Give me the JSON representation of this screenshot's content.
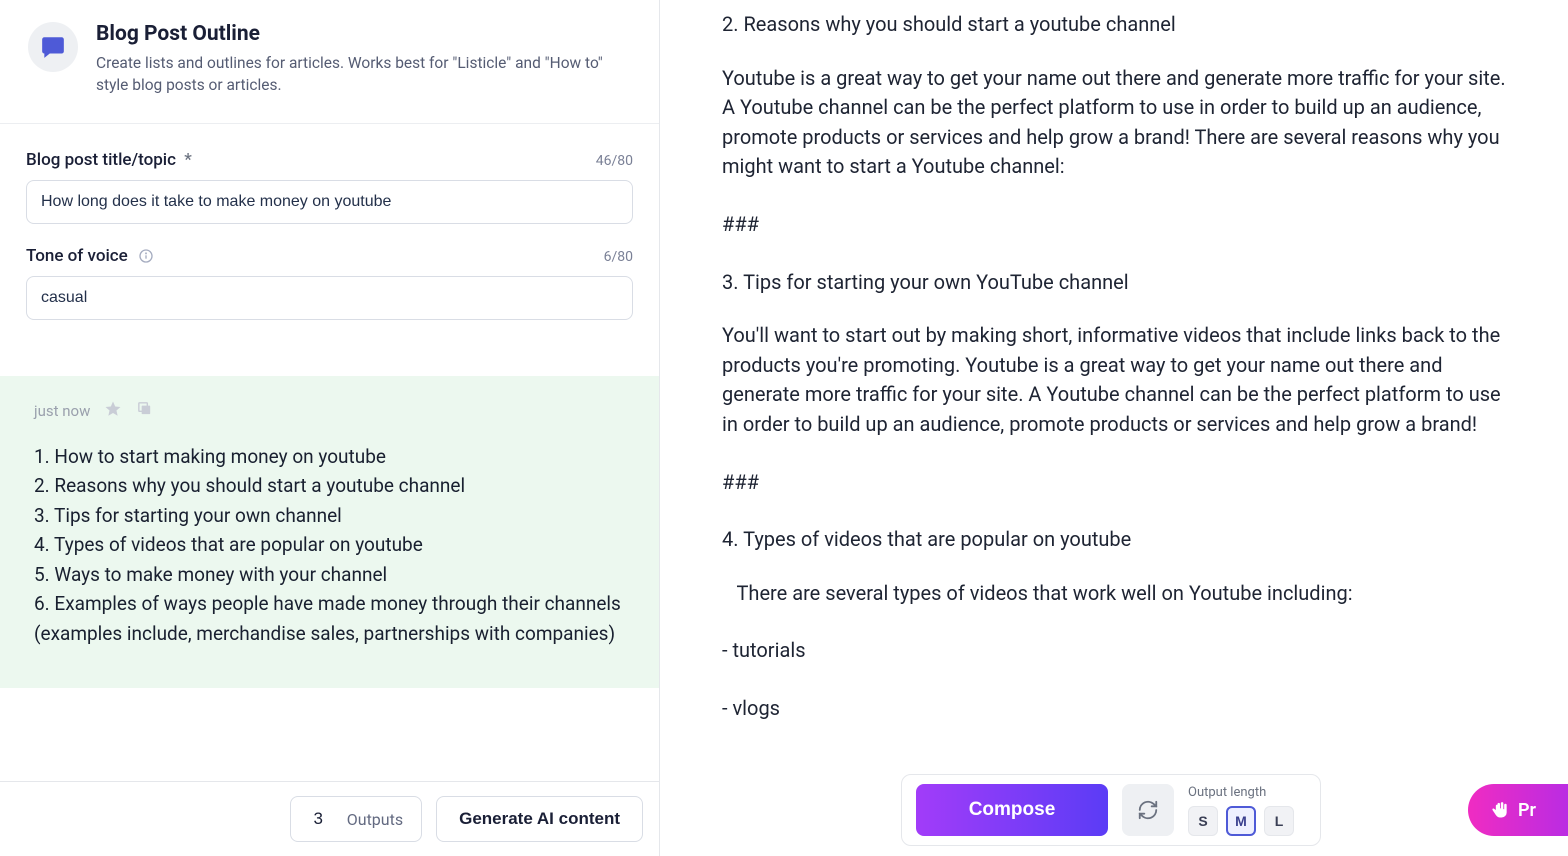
{
  "header": {
    "title": "Blog Post Outline",
    "description": "Create lists and outlines for articles. Works best for \"Listicle\" and \"How to\" style blog posts or articles."
  },
  "fields": {
    "title": {
      "label": "Blog post title/topic",
      "required_marker": "*",
      "value": "How long does it take to make money on youtube",
      "char_count": "46/80"
    },
    "tone": {
      "label": "Tone of voice",
      "value": "casual",
      "char_count": "6/80"
    }
  },
  "output": {
    "timestamp": "just now",
    "lines": [
      "1. How to start making money on youtube",
      "2. Reasons why you should start a youtube channel",
      "3. Tips for starting your own channel",
      "4. Types of videos that are popular on youtube",
      "5. Ways to make money with your channel",
      "6. Examples of ways people have made money through their channels (examples include, merchandise sales, partnerships with companies)"
    ]
  },
  "footer": {
    "outputs_count": "3",
    "outputs_label": "Outputs",
    "generate_label": "Generate AI content"
  },
  "doc": {
    "h2": "2. Reasons why you should start a youtube channel",
    "p2": "Youtube is a great way to get your name out there and generate more traffic for your site. A Youtube channel can be the perfect platform to use in order to build up an audience, promote products or services and help grow a brand! There are several reasons why you might want to start a Youtube channel:",
    "sep": "###",
    "h3": "3. Tips for starting your own YouTube channel",
    "p3": "You'll want to start out by making short, informative videos that include links back to the products you're promoting. Youtube is a great way to get your name out there and generate more traffic for your site. A Youtube channel can be the perfect platform to use in order to build up an audience, promote products or services and help grow a brand!",
    "h4": "4. Types of videos that are popular on youtube",
    "p4": "   There are several types of videos that work well on Youtube including:",
    "li1": "- tutorials",
    "li2": "- vlogs"
  },
  "compose": {
    "button": "Compose",
    "length_label": "Output length",
    "sizes": {
      "s": "S",
      "m": "M",
      "l": "L"
    }
  },
  "pink": {
    "label": "Pr"
  }
}
